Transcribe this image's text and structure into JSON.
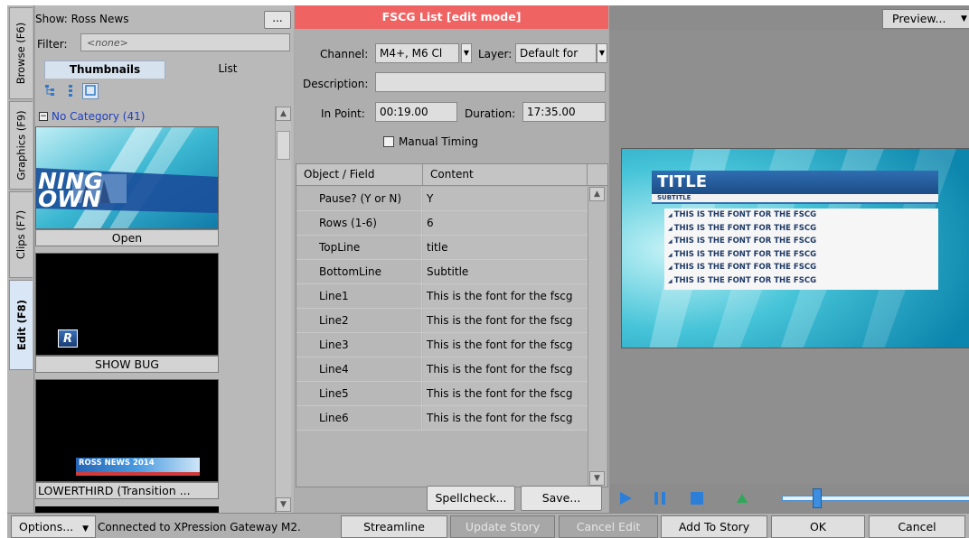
{
  "tabs": [
    {
      "label": "Browse (F6)"
    },
    {
      "label": "Graphics (F9)"
    },
    {
      "label": "Clips (F7)"
    },
    {
      "label": "Edit (F8)"
    }
  ],
  "left": {
    "show_label": "Show:",
    "show_value": "Ross News",
    "dots": "...",
    "filter_label": "Filter:",
    "filter_value": "<none>",
    "view_tabs": [
      "Thumbnails",
      "List"
    ],
    "category": "No Category (41)",
    "thumbnails": [
      {
        "caption": "Open",
        "overlay": "NING\nOWN"
      },
      {
        "caption": "SHOW BUG",
        "overlay": "R"
      },
      {
        "caption": "LOWERTHIRD (Transition ...",
        "overlay": "ROSS NEWS 2014"
      }
    ]
  },
  "mid": {
    "title": "FSCG List [edit mode]",
    "channel_label": "Channel:",
    "channel_value": "M4+, M6 Cl",
    "layer_label": "Layer:",
    "layer_value": "Default for",
    "description_label": "Description:",
    "description_value": "",
    "inpoint_label": "In Point:",
    "inpoint_value": "00:19.00",
    "duration_label": "Duration:",
    "duration_value": "17:35.00",
    "manual_timing": "Manual Timing",
    "columns": [
      "Object / Field",
      "Content"
    ],
    "rows": [
      {
        "field": "Pause? (Y or N)",
        "content": "Y"
      },
      {
        "field": "Rows (1-6)",
        "content": "6"
      },
      {
        "field": "TopLine",
        "content": "title"
      },
      {
        "field": "BottomLine",
        "content": "Subtitle"
      },
      {
        "field": "Line1",
        "content": "This is the font for the fscg"
      },
      {
        "field": "Line2",
        "content": "This is the font for the fscg"
      },
      {
        "field": "Line3",
        "content": "This is the font for the fscg"
      },
      {
        "field": "Line4",
        "content": "This is the font for the fscg"
      },
      {
        "field": "Line5",
        "content": "This is the font for the fscg"
      },
      {
        "field": "Line6",
        "content": "This is the font for the fscg"
      }
    ],
    "spellcheck": "Spellcheck...",
    "save": "Save..."
  },
  "preview": {
    "button": "Preview...",
    "title": "TITLE",
    "subtitle": "SUBTITLE",
    "lines": [
      "THIS IS THE FONT FOR THE FSCG",
      "THIS IS THE FONT FOR THE FSCG",
      "THIS IS THE FONT FOR THE FSCG",
      "THIS IS THE FONT FOR THE FSCG",
      "THIS IS THE FONT FOR THE FSCG",
      "THIS IS THE FONT FOR THE FSCG"
    ]
  },
  "bottom": {
    "options": "Options...",
    "status": "Connected to XPression Gateway M2.",
    "streamline": "Streamline",
    "update_story": "Update Story",
    "cancel_edit": "Cancel Edit",
    "add_to_story": "Add To Story",
    "ok": "OK",
    "cancel": "Cancel"
  }
}
